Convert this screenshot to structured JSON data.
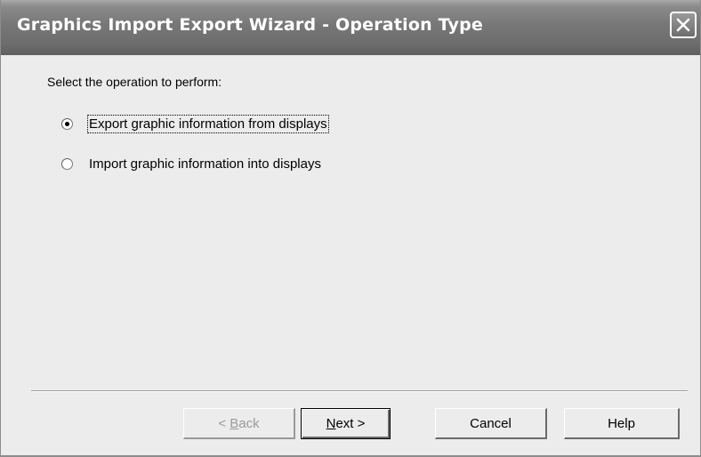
{
  "window": {
    "title": "Graphics Import Export Wizard - Operation Type"
  },
  "content": {
    "prompt": "Select the operation to perform:",
    "options": [
      {
        "label": "Export graphic information from displays",
        "selected": true
      },
      {
        "label": "Import graphic information into displays",
        "selected": false
      }
    ]
  },
  "buttons": {
    "back": {
      "prefix": "< ",
      "mnemonic": "B",
      "rest": "ack",
      "enabled": false
    },
    "next": {
      "mnemonic": "N",
      "rest": "ext >",
      "enabled": true
    },
    "cancel": "Cancel",
    "help": "Help"
  },
  "icons": {
    "close": "close-icon"
  }
}
